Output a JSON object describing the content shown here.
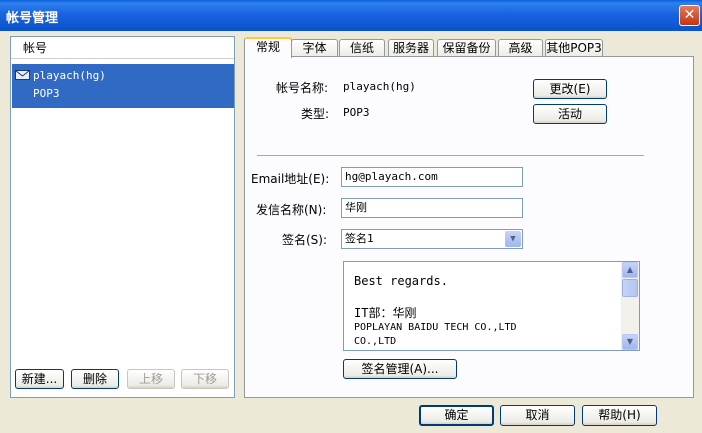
{
  "window": {
    "title": "帐号管理",
    "close_symbol": "✕"
  },
  "left": {
    "header": "帐号",
    "accounts": [
      {
        "name": "playach(hg)",
        "type": "POP3"
      }
    ],
    "buttons": {
      "new": "新建...",
      "delete": "删除",
      "up": "上移",
      "down": "下移"
    }
  },
  "tabs": [
    "常规",
    "字体",
    "信纸",
    "服务器",
    "保留备份",
    "高级",
    "其他POP3"
  ],
  "general": {
    "name_label": "帐号名称:",
    "name_value": "playach(hg)",
    "change_button": "更改(E)",
    "type_label": "类型:",
    "type_value": "POP3",
    "activate_button": "活动",
    "email_label": "Email地址(E):",
    "email_value": "hg@playach.com",
    "sender_label": "发信名称(N):",
    "sender_value": "华刚",
    "signature_label": "签名(S):",
    "signature_value": "签名1",
    "signature_text": [
      "Best regards.",
      "",
      "IT部：华刚",
      "POPLAYAN BAIDU TECH CO.,LTD",
      "CO.,LTD"
    ],
    "manage_button": "签名管理(A)..."
  },
  "footer": {
    "ok": "确定",
    "cancel": "取消",
    "help": "帮助(H)"
  },
  "colors": {
    "title_bar": "#0b52cc",
    "selection": "#316ac5",
    "dialog_bg": "#ece9d8",
    "active_tab_accent": "#ffc83c"
  }
}
